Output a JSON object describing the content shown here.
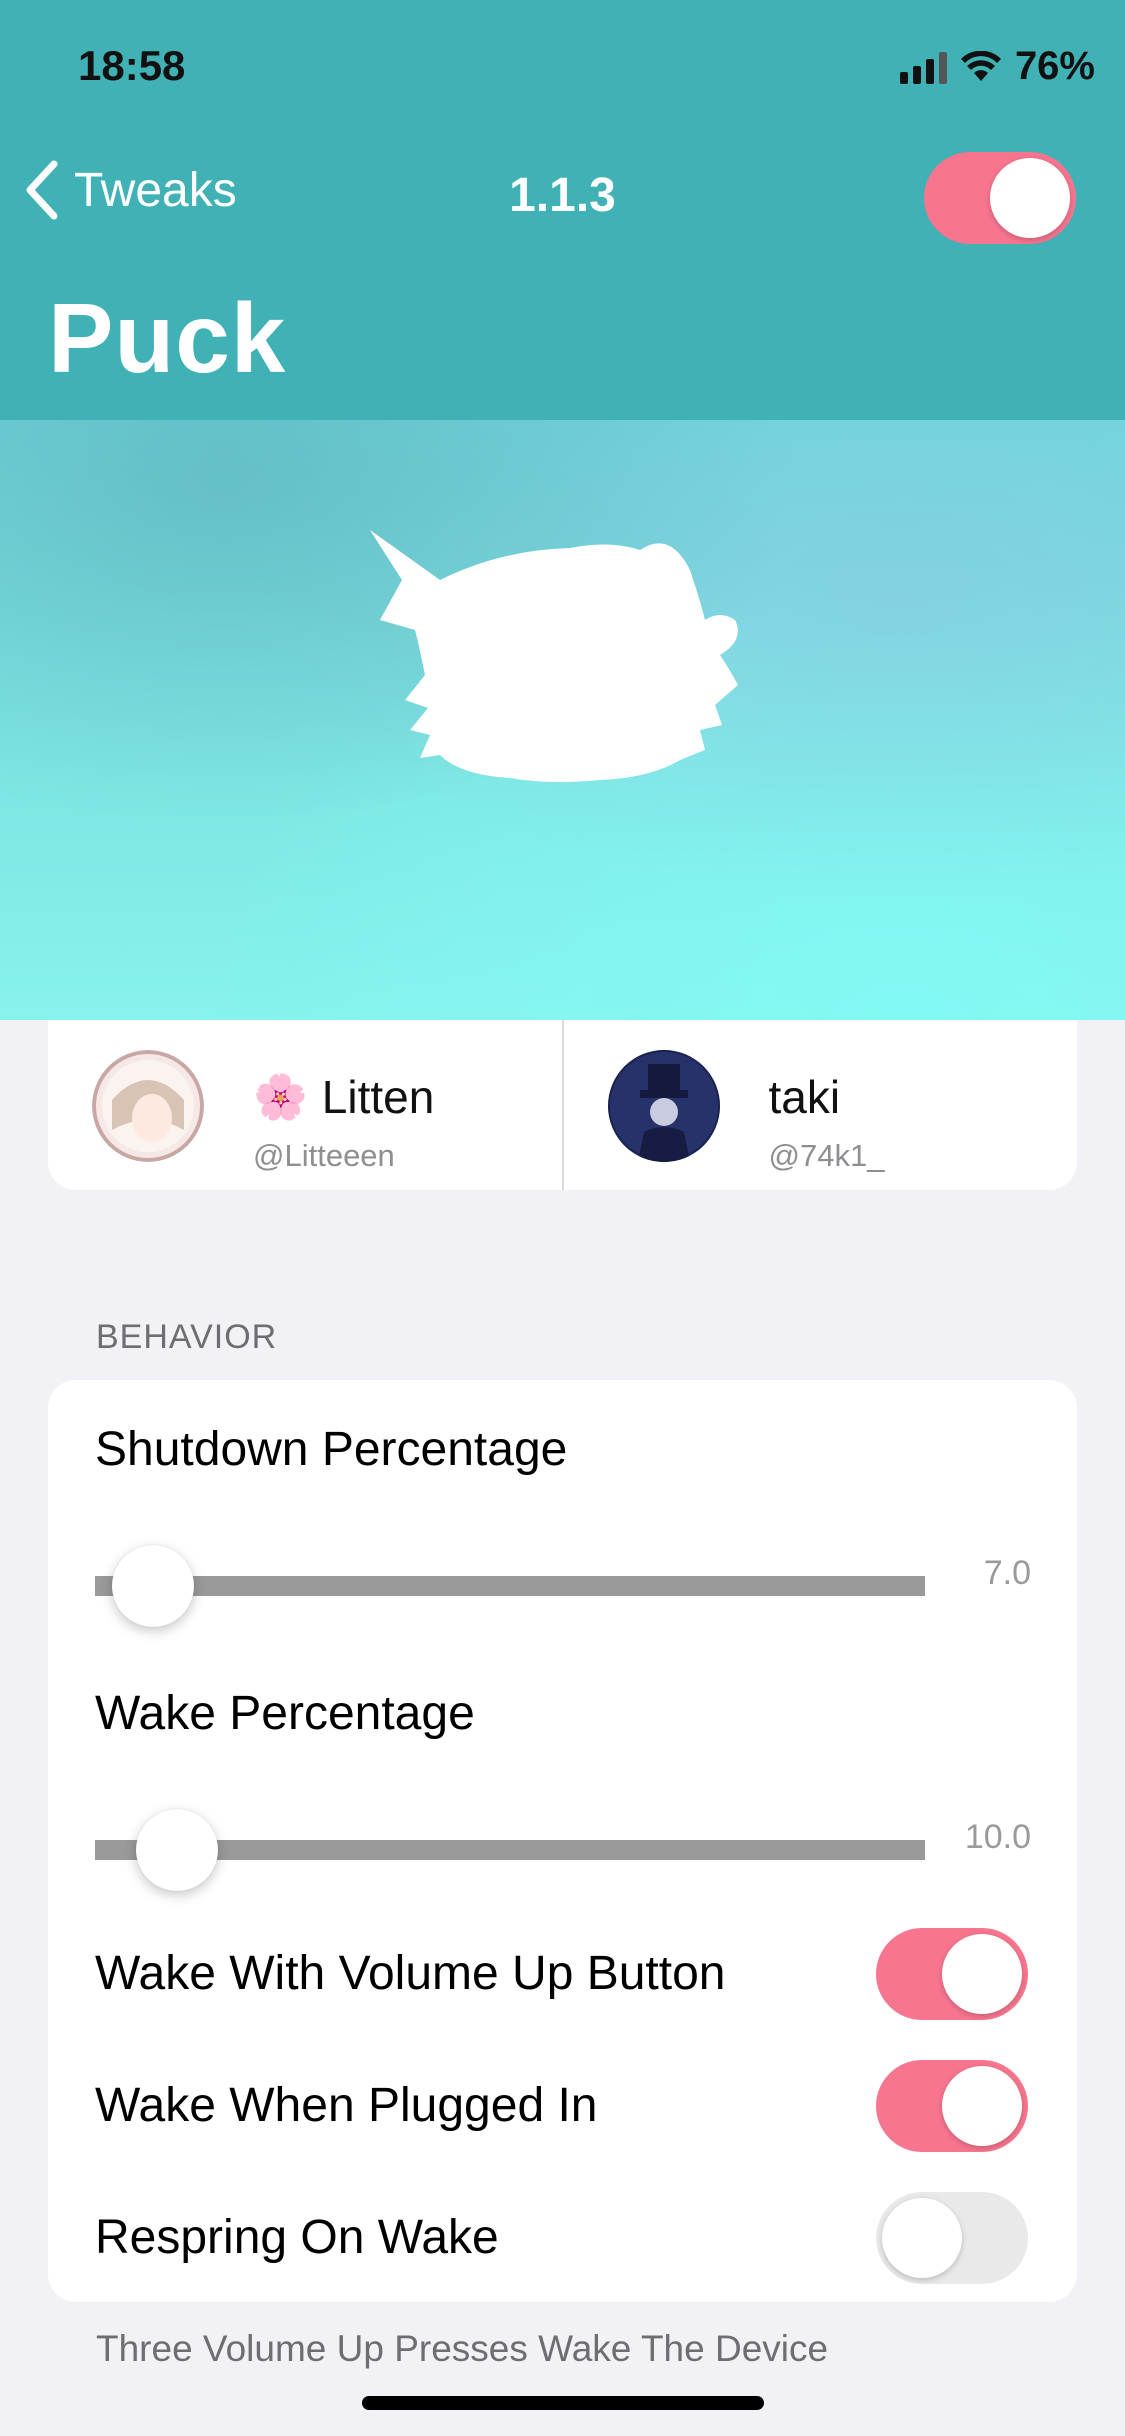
{
  "status_bar": {
    "time": "18:58",
    "battery": "76%"
  },
  "nav": {
    "back_label": "Tweaks",
    "version": "1.1.3",
    "enabled": true
  },
  "title": "Puck",
  "creators": [
    {
      "emoji": "🌸",
      "name": "Litten",
      "handle": "@Litteeen"
    },
    {
      "emoji": "",
      "name": "taki",
      "handle": "@74k1_"
    }
  ],
  "behavior": {
    "header": "BEHAVIOR",
    "shutdown": {
      "label": "Shutdown Percentage",
      "value": "7.0"
    },
    "wake": {
      "label": "Wake Percentage",
      "value": "10.0"
    },
    "toggles": [
      {
        "label": "Wake With Volume Up Button",
        "on": true
      },
      {
        "label": "Wake When Plugged In",
        "on": true
      },
      {
        "label": "Respring On Wake",
        "on": false
      }
    ],
    "footer": "Three Volume Up Presses Wake The Device"
  },
  "colors": {
    "accent": "#f7758f",
    "header": "#40b1b4"
  }
}
